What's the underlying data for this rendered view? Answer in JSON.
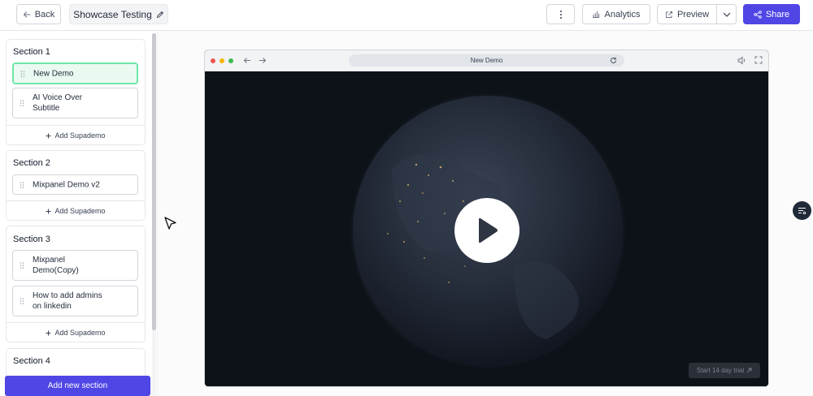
{
  "header": {
    "back_label": "Back",
    "showcase_title": "Showcase Testing",
    "analytics_label": "Analytics",
    "preview_label": "Preview",
    "share_label": "Share"
  },
  "sidebar": {
    "add_demo_label": "Add Supademo",
    "add_section_label": "Add new section",
    "sections": [
      {
        "title": "Section 1",
        "demos": [
          {
            "label": "New Demo"
          },
          {
            "label": "AI Voice Over Subtitle"
          }
        ]
      },
      {
        "title": "Section 2",
        "demos": [
          {
            "label": "Mixpanel Demo v2"
          }
        ]
      },
      {
        "title": "Section 3",
        "demos": [
          {
            "label": "Mixpanel Demo(Copy)"
          },
          {
            "label": "How to add admins on linkedin"
          }
        ]
      },
      {
        "title": "Section 4",
        "demos": []
      }
    ]
  },
  "browser": {
    "url_title": "New Demo",
    "trial_label": "Start 14 day trial"
  },
  "colors": {
    "accent": "#4f46e5",
    "active_demo_border": "#6ee7a8",
    "video_bg": "#0d1118"
  }
}
